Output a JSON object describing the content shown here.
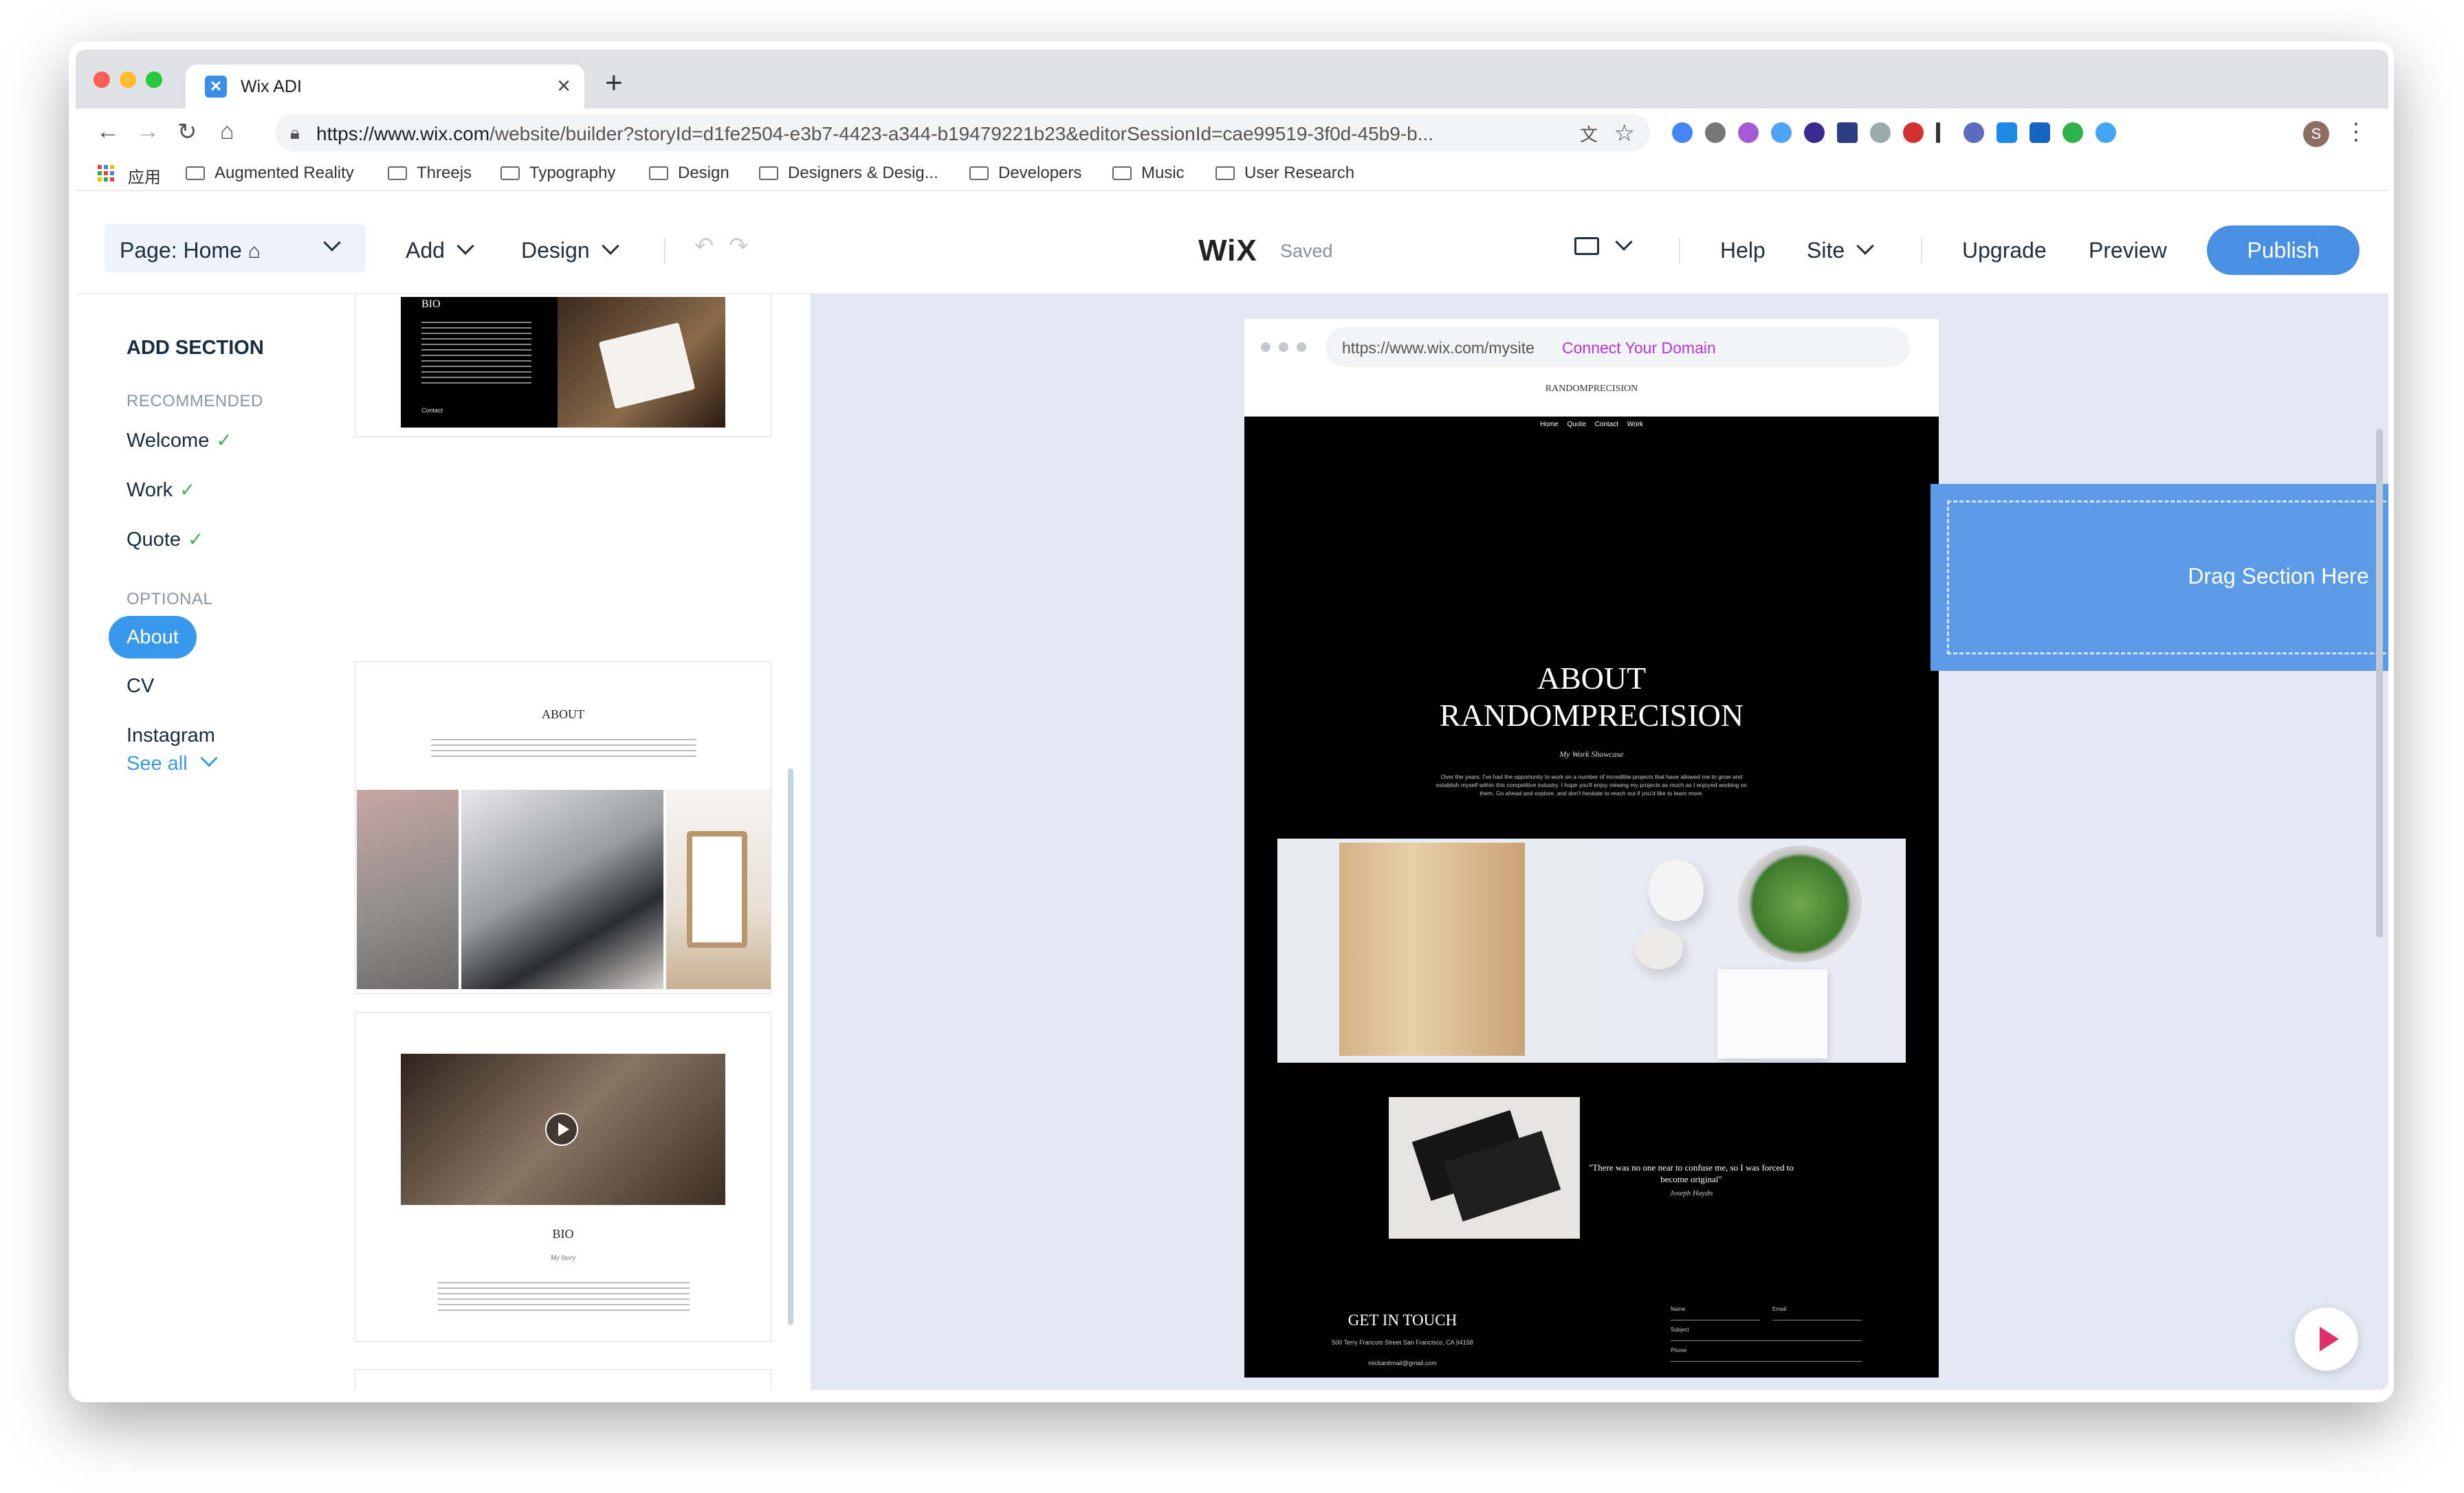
{
  "browser": {
    "tab_title": "Wix ADI",
    "url_host": "https://www.wix.com",
    "url_path": "/website/builder?storyId=d1fe2504-e3b7-4423-a344-b19479221b23&editorSessionId=cae99519-3f0d-45b9-b...",
    "bookmarks": [
      "应用",
      "Augmented Reality",
      "Threejs",
      "Typography",
      "Design",
      "Designers & Desig...",
      "Developers",
      "Music",
      "User Research"
    ],
    "profile_initial": "S"
  },
  "topbar": {
    "page_label": "Page: Home",
    "add": "Add",
    "design": "Design",
    "logo": "WiX",
    "saved": "Saved",
    "help": "Help",
    "site": "Site",
    "upgrade": "Upgrade",
    "preview": "Preview",
    "publish": "Publish"
  },
  "panel": {
    "title": "ADD SECTION",
    "recommended_label": "RECOMMENDED",
    "recommended": [
      "Welcome",
      "Work",
      "Quote"
    ],
    "optional_label": "OPTIONAL",
    "optional": [
      "About",
      "CV",
      "Instagram"
    ],
    "see_all": "See all",
    "card1": {
      "heading": "BIO",
      "link": "Contact"
    },
    "card2": {
      "heading": "ABOUT"
    },
    "card3": {
      "heading": "BIO",
      "sub": "My Story"
    }
  },
  "preview": {
    "url": "https://www.wix.com/mysite",
    "connect": "Connect Your Domain",
    "site_name": "RANDOMPRECISION",
    "nav": "Home Quote Contact Work",
    "drop_text": "Drag Section Here",
    "about_title_1": "ABOUT",
    "about_title_2": "RANDOMPRECISION",
    "showcase": "My Work Showcase",
    "about_body": "Over the years, I've had the opportunity to work on a number of incredible projects that have allowed me to grow and establish myself within this competitive industry. I hope you'll enjoy viewing my projects as much as I enjoyed working on them. Go ahead and explore, and don't hesitate to reach out if you'd like to learn more.",
    "quote": "\"There was no one near to confuse me, so I was forced to become original\"",
    "quote_author": "Joseph Haydn",
    "get_in_touch": "GET IN TOUCH",
    "address": "500 Terry Francois Street San Francisco, CA 94158",
    "email": "mickanitmail@gmail.com",
    "form_labels": [
      "Name",
      "Email",
      "Subject",
      "Phone"
    ]
  },
  "colors": {
    "accent": "#4a90e2",
    "pill": "#3899ec",
    "dropzone": "#5b9be6",
    "check": "#4caf50",
    "connect": "#b535d6"
  }
}
